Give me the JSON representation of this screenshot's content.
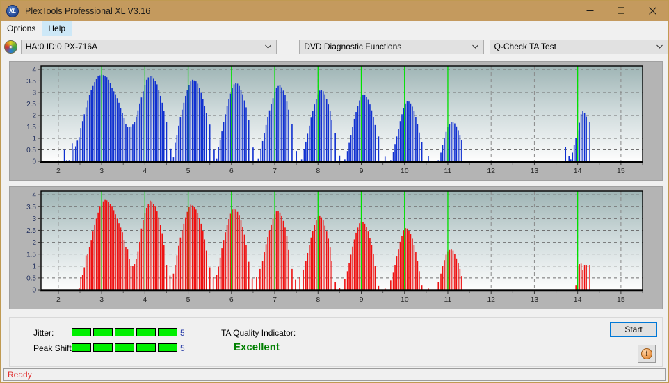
{
  "window": {
    "title": "PlexTools Professional XL V3.16",
    "app_icon": "xl-disc-icon",
    "icon_text": "XL",
    "titlebar_color": "#c49a5e",
    "minimize_label": "minimize-icon",
    "maximize_label": "maximize-icon",
    "close_label": "close-icon"
  },
  "menubar": {
    "items": [
      {
        "label": "Options",
        "hover": false
      },
      {
        "label": "Help",
        "hover": true
      }
    ]
  },
  "toolbar": {
    "drive_icon": "disc-icon",
    "drive": "HA:0 ID:0  PX-716A",
    "function": "DVD Diagnostic Functions",
    "test": "Q-Check TA Test"
  },
  "results": {
    "jitter_label": "Jitter:",
    "jitter_value": "5",
    "jitter_segments": 5,
    "peak_shift_label": "Peak Shift:",
    "peak_shift_value": "5",
    "peak_shift_segments": 5,
    "segment_color": "#00ef00",
    "ta_quality_label": "TA Quality Indicator:",
    "ta_quality_value": "Excellent",
    "ta_quality_color": "#008000",
    "start_label": "Start",
    "info_label": "i"
  },
  "statusbar": {
    "text": "Ready"
  },
  "chart_data": [
    {
      "id": "ta-jitter-chart",
      "type": "bar",
      "title": "",
      "xlabel": "",
      "ylabel": "",
      "series_color": "#1030d0",
      "marker_color": "#00e000",
      "xlim": [
        1.6,
        15.5
      ],
      "ylim": [
        0,
        4.15
      ],
      "xticks": [
        2,
        3,
        4,
        5,
        6,
        7,
        8,
        9,
        10,
        11,
        12,
        13,
        14,
        15
      ],
      "yticks": [
        0,
        0.5,
        1,
        1.5,
        2,
        2.5,
        3,
        3.5,
        4
      ],
      "grid": true,
      "markers": [
        3,
        4,
        5,
        6,
        7,
        8,
        9,
        10,
        11,
        14
      ],
      "peak_heights": [
        3.78,
        3.72,
        3.55,
        3.42,
        3.3,
        3.1,
        2.9,
        2.62,
        1.72,
        2.18
      ],
      "bar_width": 0.022,
      "x": [
        2.14,
        2.19,
        2.25,
        2.32,
        2.36,
        2.4,
        2.44,
        2.48,
        2.52,
        2.56,
        2.6,
        2.64,
        2.68,
        2.72,
        2.76,
        2.8,
        2.84,
        2.88,
        2.92,
        2.96,
        3.0,
        3.04,
        3.08,
        3.12,
        3.16,
        3.2,
        3.24,
        3.28,
        3.32,
        3.36,
        3.4,
        3.44,
        3.48,
        3.52,
        3.56,
        3.6,
        3.64,
        3.68,
        3.72,
        3.76,
        3.8,
        3.84,
        3.88,
        3.92,
        3.96,
        4.0,
        4.04,
        4.08,
        4.12,
        4.16,
        4.2,
        4.24,
        4.28,
        4.32,
        4.36,
        4.4,
        4.44,
        4.5,
        4.6,
        4.66,
        4.7,
        4.74,
        4.78,
        4.82,
        4.86,
        4.9,
        4.94,
        4.98,
        5.02,
        5.06,
        5.1,
        5.14,
        5.18,
        5.22,
        5.26,
        5.3,
        5.34,
        5.38,
        5.42,
        5.5,
        5.6,
        5.66,
        5.7,
        5.74,
        5.78,
        5.82,
        5.86,
        5.9,
        5.94,
        5.98,
        6.02,
        6.06,
        6.1,
        6.14,
        6.18,
        6.22,
        6.26,
        6.3,
        6.34,
        6.4,
        6.5,
        6.62,
        6.68,
        6.72,
        6.76,
        6.8,
        6.84,
        6.88,
        6.92,
        6.96,
        7.0,
        7.04,
        7.08,
        7.12,
        7.16,
        7.2,
        7.24,
        7.28,
        7.32,
        7.4,
        7.5,
        7.62,
        7.68,
        7.72,
        7.76,
        7.8,
        7.84,
        7.88,
        7.92,
        7.96,
        8.0,
        8.04,
        8.08,
        8.12,
        8.16,
        8.2,
        8.24,
        8.28,
        8.32,
        8.4,
        8.5,
        8.62,
        8.68,
        8.72,
        8.76,
        8.8,
        8.84,
        8.88,
        8.92,
        8.96,
        9.0,
        9.04,
        9.08,
        9.12,
        9.16,
        9.2,
        9.24,
        9.28,
        9.32,
        9.4,
        9.55,
        9.68,
        9.74,
        9.78,
        9.82,
        9.86,
        9.9,
        9.94,
        9.98,
        10.02,
        10.06,
        10.1,
        10.14,
        10.18,
        10.22,
        10.26,
        10.3,
        10.34,
        10.4,
        10.55,
        10.78,
        10.84,
        10.88,
        10.92,
        10.96,
        11.0,
        11.04,
        11.08,
        11.12,
        11.16,
        11.2,
        11.24,
        11.28,
        11.32,
        13.72,
        13.8,
        13.84,
        13.88,
        13.92,
        13.96,
        14.0,
        14.04,
        14.08,
        14.12,
        14.16,
        14.2,
        14.28
      ],
      "y": [
        0.5,
        0.05,
        0.05,
        0.78,
        0.52,
        0.65,
        0.9,
        1.05,
        1.45,
        1.75,
        2.05,
        2.35,
        2.65,
        2.9,
        3.1,
        3.28,
        3.45,
        3.58,
        3.7,
        3.74,
        3.78,
        3.75,
        3.72,
        3.66,
        3.55,
        3.4,
        3.2,
        3.05,
        2.92,
        2.75,
        2.55,
        2.32,
        2.1,
        1.88,
        1.62,
        1.5,
        1.5,
        1.52,
        1.6,
        1.7,
        1.95,
        2.22,
        2.52,
        2.78,
        3.05,
        3.32,
        3.55,
        3.65,
        3.72,
        3.7,
        3.62,
        3.5,
        3.35,
        3.1,
        2.85,
        2.55,
        2.2,
        1.7,
        0.55,
        0.18,
        0.8,
        1.15,
        1.55,
        1.92,
        2.25,
        2.55,
        2.85,
        3.12,
        3.32,
        3.48,
        3.55,
        3.52,
        3.48,
        3.38,
        3.2,
        2.98,
        2.7,
        2.4,
        2.1,
        1.6,
        0.5,
        0.1,
        0.62,
        0.95,
        1.3,
        1.7,
        2.05,
        2.4,
        2.7,
        2.95,
        3.18,
        3.35,
        3.42,
        3.38,
        3.28,
        3.12,
        2.92,
        2.65,
        2.35,
        1.8,
        0.6,
        0.1,
        0.55,
        0.88,
        1.22,
        1.58,
        1.92,
        2.22,
        2.5,
        2.75,
        3.0,
        3.18,
        3.28,
        3.3,
        3.22,
        3.08,
        2.88,
        2.6,
        2.25,
        1.62,
        0.45,
        0.08,
        0.52,
        0.85,
        1.2,
        1.55,
        1.9,
        2.2,
        2.48,
        2.72,
        2.92,
        3.08,
        3.1,
        3.05,
        2.92,
        2.72,
        2.48,
        2.18,
        1.8,
        1.22,
        0.25,
        0.08,
        0.45,
        0.8,
        1.15,
        1.5,
        1.85,
        2.15,
        2.42,
        2.65,
        2.82,
        2.9,
        2.88,
        2.8,
        2.68,
        2.48,
        2.22,
        1.92,
        1.58,
        1.08,
        0.2,
        0.05,
        0.42,
        0.75,
        1.08,
        1.42,
        1.75,
        2.05,
        2.32,
        2.52,
        2.62,
        2.6,
        2.52,
        2.38,
        2.18,
        1.92,
        1.62,
        1.25,
        0.82,
        0.22,
        0.05,
        0.38,
        0.72,
        1.02,
        1.28,
        1.5,
        1.62,
        1.7,
        1.72,
        1.65,
        1.52,
        1.35,
        1.15,
        0.92,
        0.62,
        0.22,
        0.08,
        0.38,
        0.72,
        1.02,
        1.35,
        1.68,
        2.05,
        2.18,
        2.12,
        1.95,
        1.72,
        1.42,
        1.08,
        0.22
      ]
    },
    {
      "id": "ta-peakshift-chart",
      "type": "bar",
      "title": "",
      "xlabel": "",
      "ylabel": "",
      "series_color": "#ee1111",
      "marker_color": "#00e000",
      "xlim": [
        1.6,
        15.5
      ],
      "ylim": [
        0,
        4.15
      ],
      "xticks": [
        2,
        3,
        4,
        5,
        6,
        7,
        8,
        9,
        10,
        11,
        12,
        13,
        14,
        15
      ],
      "yticks": [
        0,
        0.5,
        1,
        1.5,
        2,
        2.5,
        3,
        3.5,
        4
      ],
      "grid": true,
      "markers": [
        3,
        4,
        5,
        6,
        7,
        8,
        9,
        10,
        11,
        14
      ],
      "peak_heights": [
        3.78,
        3.75,
        3.58,
        3.42,
        3.32,
        3.1,
        2.88,
        2.6,
        1.72,
        1.1
      ],
      "bar_width": 0.022,
      "x": [
        2.48,
        2.52,
        2.56,
        2.6,
        2.64,
        2.68,
        2.72,
        2.76,
        2.8,
        2.84,
        2.88,
        2.92,
        2.96,
        3.0,
        3.04,
        3.08,
        3.12,
        3.16,
        3.2,
        3.24,
        3.28,
        3.32,
        3.36,
        3.4,
        3.44,
        3.48,
        3.52,
        3.56,
        3.6,
        3.64,
        3.68,
        3.72,
        3.76,
        3.8,
        3.84,
        3.88,
        3.92,
        3.96,
        4.0,
        4.04,
        4.08,
        4.12,
        4.16,
        4.2,
        4.24,
        4.28,
        4.32,
        4.36,
        4.4,
        4.44,
        4.5,
        4.58,
        4.66,
        4.7,
        4.74,
        4.78,
        4.82,
        4.86,
        4.9,
        4.94,
        4.98,
        5.02,
        5.06,
        5.1,
        5.14,
        5.18,
        5.22,
        5.26,
        5.3,
        5.34,
        5.38,
        5.42,
        5.5,
        5.58,
        5.66,
        5.7,
        5.74,
        5.78,
        5.82,
        5.86,
        5.9,
        5.94,
        5.98,
        6.02,
        6.06,
        6.1,
        6.14,
        6.18,
        6.22,
        6.26,
        6.3,
        6.34,
        6.4,
        6.48,
        6.58,
        6.66,
        6.72,
        6.76,
        6.8,
        6.84,
        6.88,
        6.92,
        6.96,
        7.0,
        7.04,
        7.08,
        7.12,
        7.16,
        7.2,
        7.24,
        7.28,
        7.32,
        7.4,
        7.48,
        7.58,
        7.66,
        7.72,
        7.76,
        7.8,
        7.84,
        7.88,
        7.92,
        7.96,
        8.0,
        8.04,
        8.08,
        8.12,
        8.16,
        8.2,
        8.24,
        8.28,
        8.32,
        8.4,
        8.5,
        8.62,
        8.68,
        8.72,
        8.76,
        8.8,
        8.84,
        8.88,
        8.92,
        8.96,
        9.0,
        9.04,
        9.08,
        9.12,
        9.16,
        9.2,
        9.24,
        9.28,
        9.32,
        9.4,
        9.55,
        9.68,
        9.74,
        9.78,
        9.82,
        9.86,
        9.9,
        9.94,
        9.98,
        10.02,
        10.06,
        10.1,
        10.14,
        10.18,
        10.22,
        10.26,
        10.3,
        10.34,
        10.4,
        10.55,
        10.78,
        10.84,
        10.88,
        10.92,
        10.96,
        11.0,
        11.04,
        11.08,
        11.12,
        11.16,
        11.2,
        11.24,
        11.28,
        11.32,
        13.96,
        14.0,
        14.04,
        14.08,
        14.12,
        14.16,
        14.2,
        14.28
      ],
      "y": [
        0.08,
        0.55,
        0.62,
        0.95,
        1.45,
        1.5,
        1.8,
        2.1,
        2.45,
        2.75,
        3.0,
        3.25,
        3.5,
        3.55,
        3.72,
        3.78,
        3.76,
        3.7,
        3.62,
        3.5,
        3.35,
        3.18,
        3.0,
        2.8,
        2.62,
        2.42,
        2.1,
        1.8,
        1.72,
        1.3,
        1.02,
        1.0,
        1.08,
        1.3,
        1.62,
        2.02,
        2.58,
        2.95,
        3.22,
        3.45,
        3.62,
        3.75,
        3.72,
        3.62,
        3.5,
        3.3,
        3.05,
        2.72,
        2.38,
        1.9,
        1.05,
        0.6,
        0.68,
        1.05,
        1.45,
        1.85,
        2.2,
        2.5,
        2.78,
        3.05,
        3.28,
        3.48,
        3.58,
        3.55,
        3.48,
        3.38,
        3.22,
        3.02,
        2.78,
        2.48,
        2.12,
        1.65,
        0.95,
        0.55,
        0.62,
        0.98,
        1.35,
        1.75,
        2.1,
        2.42,
        2.72,
        2.98,
        3.2,
        3.38,
        3.42,
        3.38,
        3.28,
        3.12,
        2.92,
        2.65,
        2.32,
        1.88,
        1.18,
        0.48,
        0.55,
        0.88,
        1.22,
        1.58,
        1.92,
        2.22,
        2.5,
        2.75,
        3.0,
        3.18,
        3.3,
        3.32,
        3.25,
        3.1,
        2.9,
        2.62,
        2.28,
        1.7,
        0.88,
        0.42,
        0.55,
        0.85,
        1.2,
        1.55,
        1.9,
        2.2,
        2.48,
        2.72,
        2.92,
        3.08,
        3.1,
        3.05,
        2.92,
        2.7,
        2.45,
        2.15,
        1.78,
        1.2,
        0.35,
        0.08,
        0.45,
        0.78,
        1.12,
        1.48,
        1.82,
        2.12,
        2.4,
        2.62,
        2.8,
        2.88,
        2.85,
        2.78,
        2.65,
        2.45,
        2.18,
        1.88,
        1.52,
        1.02,
        0.18,
        0.05,
        0.4,
        0.72,
        1.05,
        1.4,
        1.72,
        2.02,
        2.28,
        2.5,
        2.6,
        2.58,
        2.48,
        2.35,
        2.15,
        1.88,
        1.58,
        1.2,
        0.78,
        0.2,
        0.05,
        0.35,
        0.68,
        1.0,
        1.25,
        1.48,
        1.62,
        1.7,
        1.72,
        1.65,
        1.5,
        1.32,
        1.12,
        0.88,
        0.58,
        0.2,
        1.02,
        1.08,
        1.1,
        0.82,
        1.05,
        1.05,
        1.05,
        0.42
      ]
    }
  ]
}
